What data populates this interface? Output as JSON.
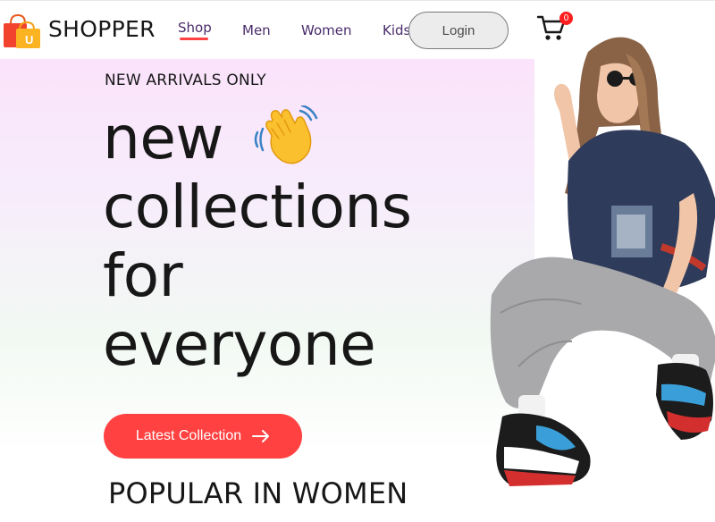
{
  "navbar": {
    "brand": "SHOPPER",
    "menu": [
      {
        "label": "Shop",
        "active": true
      },
      {
        "label": "Men",
        "active": false
      },
      {
        "label": "Women",
        "active": false
      },
      {
        "label": "Kids",
        "active": false
      }
    ],
    "login_label": "Login",
    "cart_count": "0",
    "icons": [
      "shopping-bag-logo-icon",
      "cart-icon"
    ]
  },
  "hero": {
    "eyebrow": "NEW ARRIVALS ONLY",
    "headline_lines": [
      "new",
      "collections",
      "for",
      "everyone"
    ],
    "cta_label": "Latest Collection",
    "icons": [
      "waving-hand-icon",
      "arrow-right-icon"
    ]
  },
  "section": {
    "title": "POPULAR IN WOMEN"
  },
  "colors": {
    "accent": "#ff4141",
    "nav_text": "#4a2c6b",
    "hero_gradient_top": "#fbe3fb",
    "hero_gradient_bottom": "#ffffff"
  }
}
